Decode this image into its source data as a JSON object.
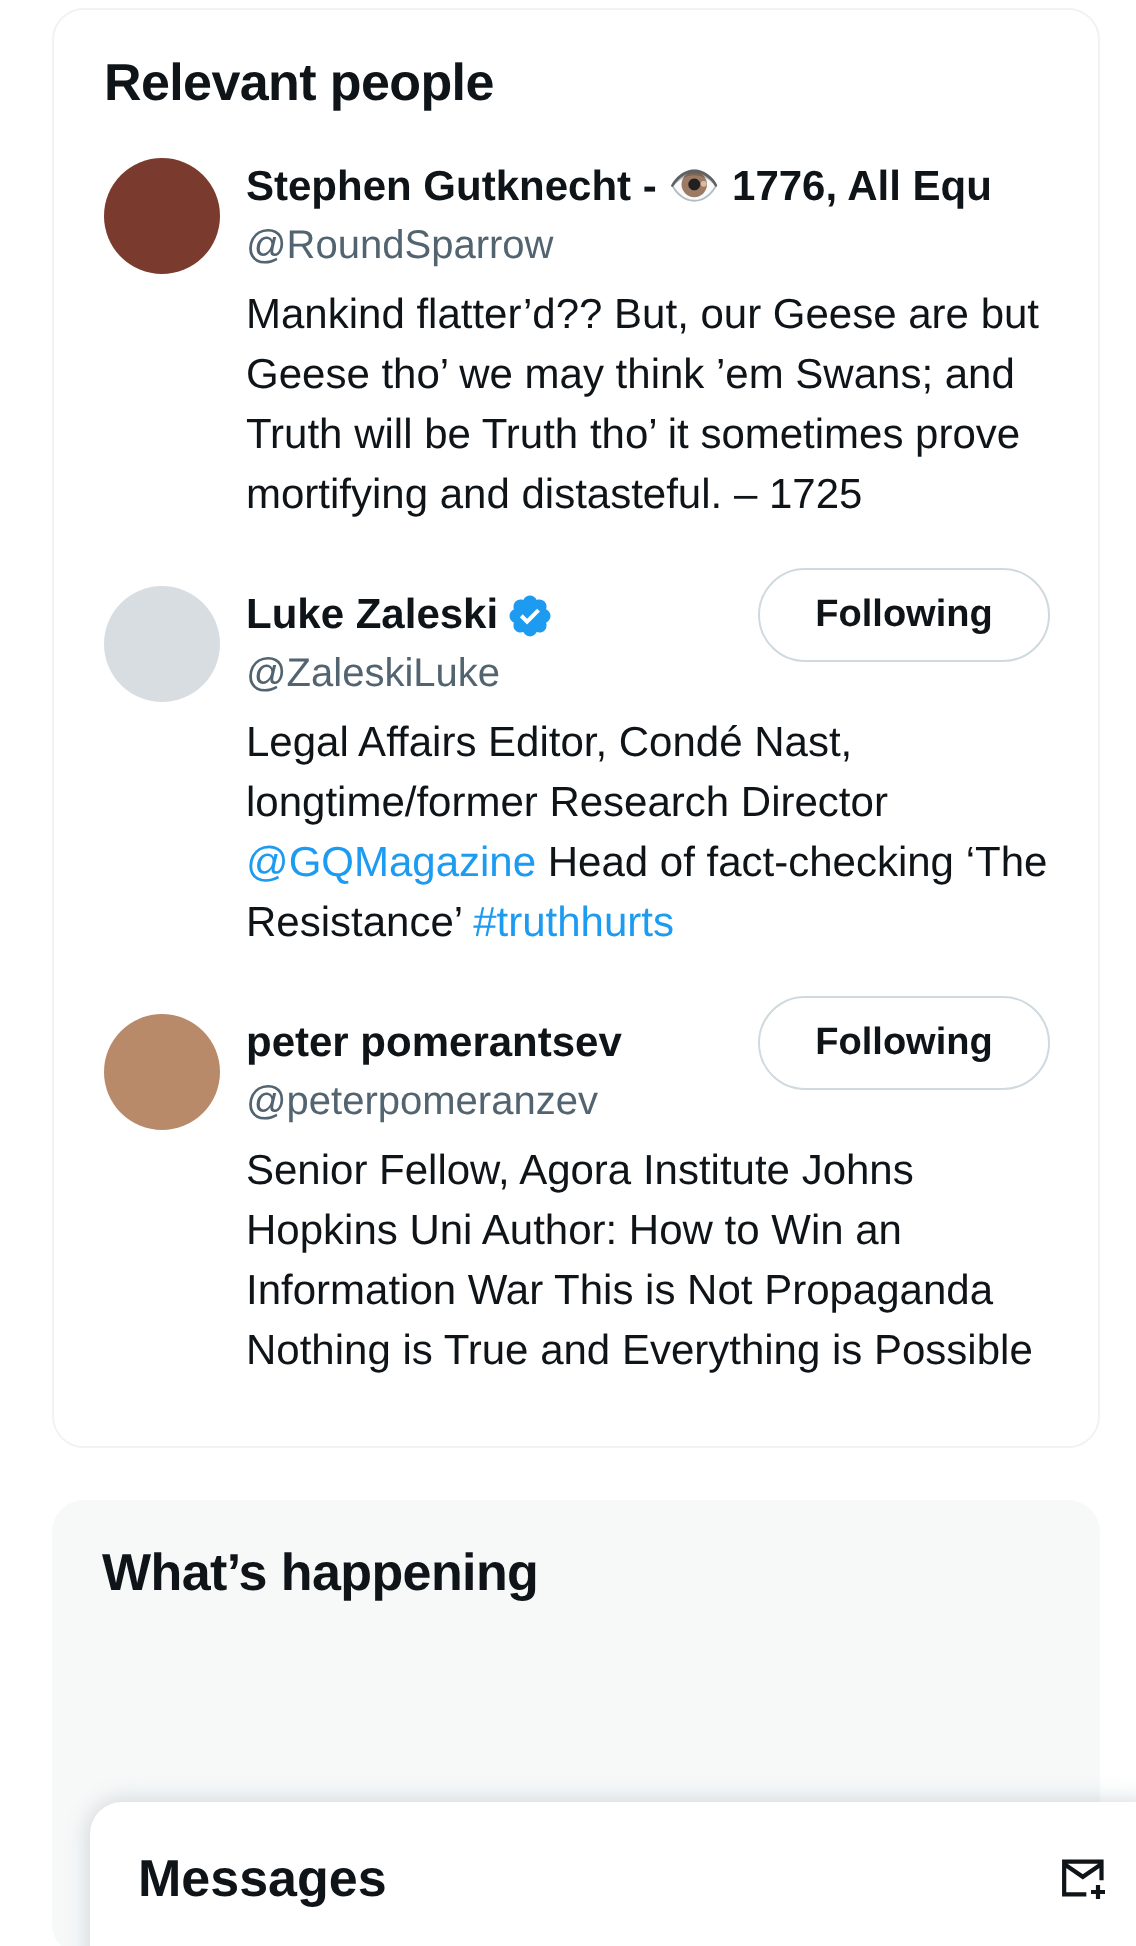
{
  "relevant_people": {
    "title": "Relevant people",
    "people": [
      {
        "name": "Stephen Gutknecht - 👁️ 1776, All Equ",
        "verified": false,
        "handle": "@RoundSparrow",
        "bio": [
          {
            "kind": "text",
            "text": "Mankind flatter’d?? But, our Geese are but Geese tho’ we may think ’em Swans; and Truth will be Truth tho’ it sometimes prove mortifying and distasteful. – 1725"
          }
        ]
      },
      {
        "name": "Luke Zaleski",
        "verified": true,
        "handle": "@ZaleskiLuke",
        "follow_button": "Following",
        "bio": [
          {
            "kind": "text",
            "text": "Legal Affairs Editor, Condé Nast, longtime/former Research Director "
          },
          {
            "kind": "link",
            "text": "@GQMagazine"
          },
          {
            "kind": "text",
            "text": " Head of fact-checking ‘The Resistance’ "
          },
          {
            "kind": "link",
            "text": "#truthhurts"
          }
        ]
      },
      {
        "name": "peter pomerantsev",
        "verified": false,
        "handle": "@peterpomeranzev",
        "follow_button": "Following",
        "bio": [
          {
            "kind": "text",
            "text": "Senior Fellow, Agora Institute Johns Hopkins Uni Author: How to Win an Information War This is Not Propaganda Nothing is True and Everything is Possible"
          }
        ]
      }
    ]
  },
  "whats_happening": {
    "title": "What’s happening"
  },
  "messages_drawer": {
    "title": "Messages"
  }
}
